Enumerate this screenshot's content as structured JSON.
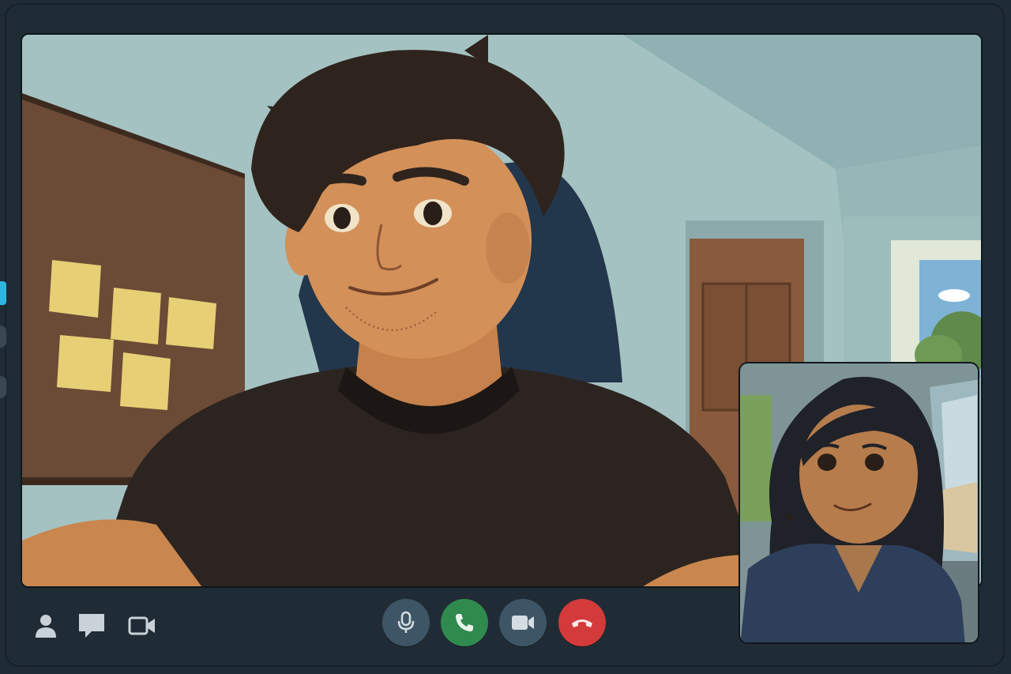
{
  "colors": {
    "window_bg": "#202c35",
    "bar_bg": "#202c35",
    "rail_accent": "#2fb6e0",
    "mic_button": "#3e5566",
    "answer_button": "#2f8a4e",
    "video_button": "#3e5566",
    "hangup_button": "#d33a3a",
    "icon_muted": "#c9d2d8"
  },
  "side_rail": {
    "items": [
      {
        "icon": "active-indicator"
      },
      {
        "icon": "rail-item"
      },
      {
        "icon": "rail-item"
      }
    ]
  },
  "left_controls": [
    {
      "icon": "person-icon"
    },
    {
      "icon": "chat-bubble-icon"
    },
    {
      "icon": "video-camera-icon"
    }
  ],
  "call_controls": [
    {
      "icon": "microphone-icon",
      "color": "#3e5566"
    },
    {
      "icon": "phone-icon",
      "color": "#2f8a4e"
    },
    {
      "icon": "video-camera-icon",
      "color": "#3e5566"
    },
    {
      "icon": "hang-up-icon",
      "color": "#d33a3a"
    }
  ],
  "participants": {
    "main": {
      "feed": "remote-participant-video"
    },
    "self": {
      "feed": "self-view-video"
    }
  }
}
